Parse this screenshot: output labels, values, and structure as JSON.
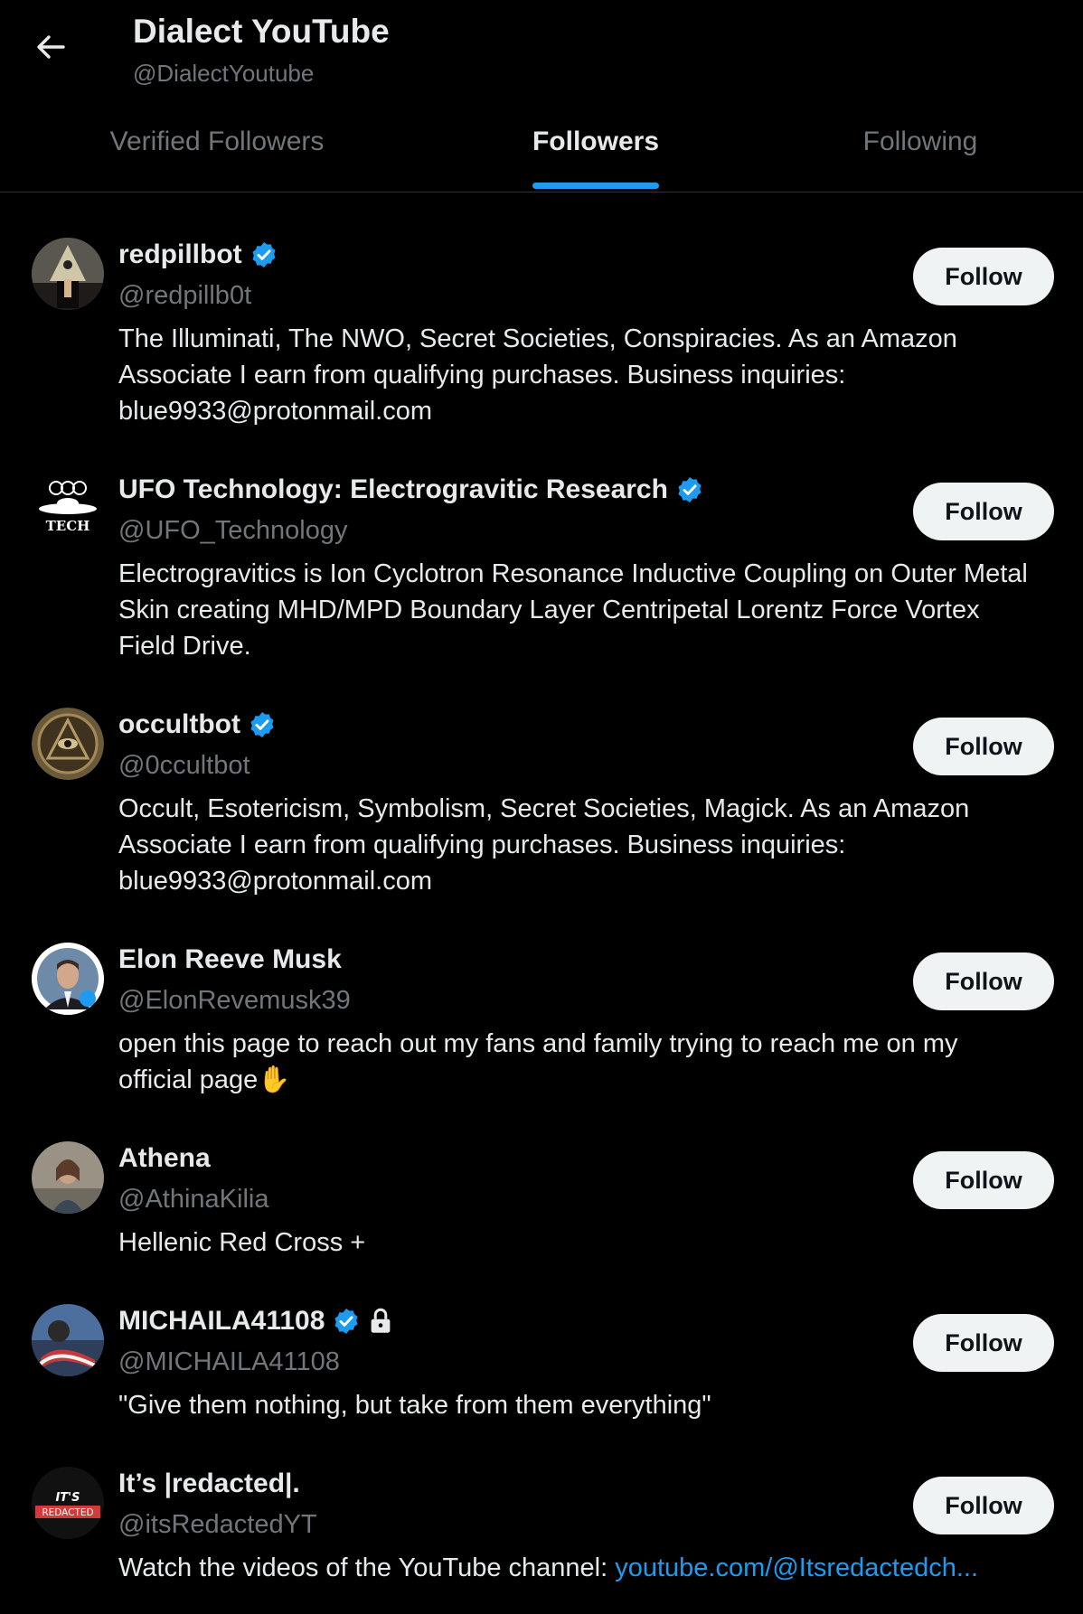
{
  "header": {
    "title": "Dialect YouTube",
    "handle": "@DialectYoutube"
  },
  "tabs": [
    {
      "label": "Verified Followers",
      "active": false
    },
    {
      "label": "Followers",
      "active": true
    },
    {
      "label": "Following",
      "active": false
    }
  ],
  "colors": {
    "accent": "#1d9bf0",
    "background": "#000000",
    "text_primary": "#e7e9ea",
    "text_secondary": "#71767b",
    "button_bg": "#eff3f4"
  },
  "followers": [
    {
      "name": "redpillbot",
      "verified": true,
      "handle": "@redpillb0t",
      "bio": "The Illuminati, The NWO, Secret Societies, Conspiracies. As an Amazon Associate I earn from qualifying purchases. Business inquiries: blue9933@protonmail.com",
      "follow_label": "Follow"
    },
    {
      "name": "UFO Technology: Electrogravitic Research",
      "verified": true,
      "handle": "@UFO_Technology",
      "bio": "Electrogravitics is Ion Cyclotron Resonance Inductive Coupling on Outer Metal Skin creating MHD/MPD Boundary Layer Centripetal Lorentz Force Vortex Field Drive.",
      "follow_label": "Follow"
    },
    {
      "name": "occultbot",
      "verified": true,
      "handle": "@0ccultbot",
      "bio": "Occult, Esotericism, Symbolism, Secret Societies, Magick. As an Amazon Associate I earn from qualifying purchases. Business inquiries: blue9933@protonmail.com",
      "follow_label": "Follow"
    },
    {
      "name": "Elon Reeve Musk",
      "verified": false,
      "handle": "@ElonRevemusk39",
      "bio": "open this page to reach out my fans and family trying to reach me on my official page✋",
      "follow_label": "Follow"
    },
    {
      "name": "Athena",
      "verified": false,
      "handle": "@AthinaKilia",
      "bio": "Hellenic Red Cross +",
      "follow_label": "Follow"
    },
    {
      "name": "MICHAILA41108",
      "verified": true,
      "protected": true,
      "handle": "@MICHAILA41108",
      "bio": "\"Give them nothing, but take from them everything\"",
      "follow_label": "Follow"
    },
    {
      "name": "It’s |redacted|.",
      "verified": false,
      "handle": "@itsRedactedYT",
      "bio": "Watch the videos of the YouTube channel: ",
      "bio_link": "youtube.com/@Itsredactedch...",
      "follow_label": "Follow"
    }
  ],
  "avatar_labels": {
    "ufo_top": "UFO",
    "ufo_bottom": "TECH",
    "redacted_top": "IT'S",
    "redacted_bottom": "REDACTED"
  }
}
